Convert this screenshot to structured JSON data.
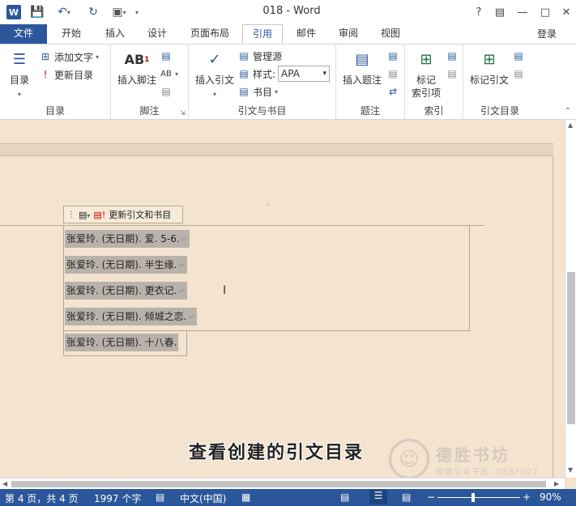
{
  "window": {
    "title": "018 - Word",
    "help": "?",
    "login": "登录"
  },
  "tabs": [
    "文件",
    "开始",
    "插入",
    "设计",
    "页面布局",
    "引用",
    "邮件",
    "审阅",
    "视图"
  ],
  "ribbon": {
    "toc": {
      "big": "目录",
      "add_text": "添加文字",
      "update_toc": "更新目录",
      "group": "目录"
    },
    "footnote": {
      "insert_footnote": "插入脚注",
      "group": "脚注"
    },
    "citation": {
      "insert_citation": "插入引文",
      "manage_sources": "管理源",
      "style_label": "样式:",
      "style_value": "APA",
      "bibliography": "书目",
      "group": "引文与书目"
    },
    "caption": {
      "insert_caption": "插入题注",
      "group": "题注"
    },
    "index": {
      "mark_entry_line1": "标记",
      "mark_entry_line2": "索引项",
      "group": "索引"
    },
    "toa": {
      "mark_citation": "标记引文",
      "group": "引文目录"
    }
  },
  "document": {
    "field_bar_label": "更新引文和书目",
    "references": [
      "张爱玲. (无日期). 爱. 5-6.",
      "张爱玲. (无日期). 半生缘.",
      "张爱玲. (无日期). 更衣记.",
      "张爱玲. (无日期). 倾城之恋.",
      "张爱玲. (无日期). 十八春."
    ],
    "caption": "查看创建的引文目录",
    "watermark_brand": "德胜书坊",
    "watermark_sub": "微信公众平台: DSSF007"
  },
  "status": {
    "page": "第 4 页，共 4 页",
    "words": "1997 个字",
    "language": "中文(中国)",
    "zoom": "90%",
    "zoom_minus": "−",
    "zoom_plus": "+"
  },
  "colors": {
    "accent": "#2b579a",
    "page_bg": "#f3e3cf",
    "highlight": "#b8b2ab"
  }
}
